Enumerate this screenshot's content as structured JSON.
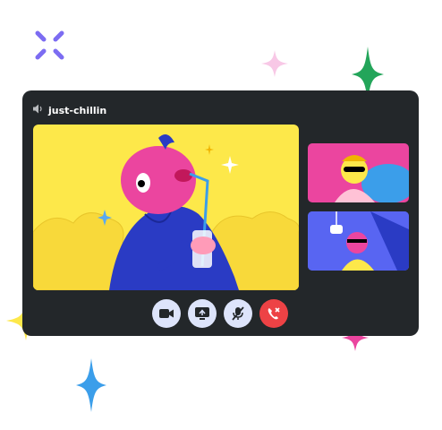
{
  "call": {
    "channel_name": "just-chillin",
    "channel_icon": "speaker-icon"
  },
  "controls": [
    {
      "name": "camera-button",
      "icon": "video-camera-icon"
    },
    {
      "name": "screen-share-button",
      "icon": "screen-share-icon"
    },
    {
      "name": "mute-button",
      "icon": "microphone-muted-icon"
    },
    {
      "name": "leave-call-button",
      "icon": "hang-up-icon"
    }
  ],
  "colors": {
    "window": "#23272a",
    "main_video": "#fde84a",
    "tile_pink": "#eb459f",
    "tile_blue": "#5865f2",
    "control_button": "#dde4fb",
    "hangup_button": "#ed4245",
    "sparkle_green": "#23a55a",
    "sparkle_blue": "#3b9eea",
    "sparkle_yellow": "#fde84a",
    "sparkle_pink": "#eb459f",
    "sparkle_lightpink": "#f8c8e6",
    "brand_x": "#7c6cf2"
  }
}
